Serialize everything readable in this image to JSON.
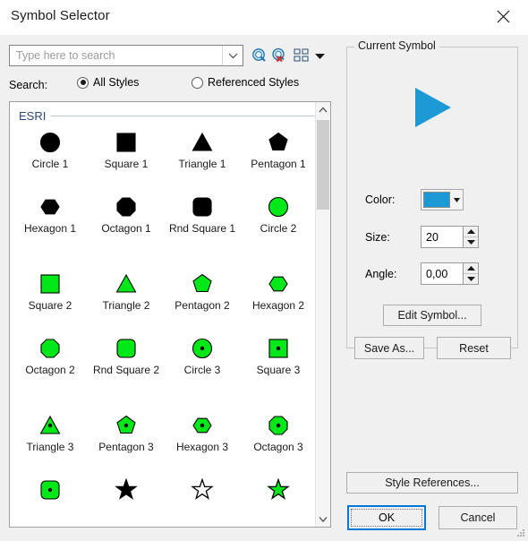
{
  "window": {
    "title": "Symbol Selector",
    "close_icon": "close-icon"
  },
  "search": {
    "placeholder": "Type here to search",
    "value": "",
    "combo_arrow_icon": "chevron-down-icon",
    "go_icon": "search-magnifier-icon",
    "clear_icon": "search-clear-icon",
    "view_mode_icon": "grid-view-icon",
    "view_mode_arrow_icon": "dropdown-arrow-icon",
    "label": "Search:",
    "options": [
      {
        "label": "All Styles",
        "checked": true
      },
      {
        "label": "Referenced Styles",
        "checked": false
      }
    ]
  },
  "symbol_list": {
    "category": "ESRI",
    "scrollbar": {
      "up_icon": "chevron-up-icon",
      "down_icon": "chevron-down-icon"
    },
    "rows": [
      [
        {
          "label": "Circle 1",
          "shape": "circle",
          "fill": "#000000",
          "stroke": "#000000",
          "dot": false
        },
        {
          "label": "Square 1",
          "shape": "square",
          "fill": "#000000",
          "stroke": "#000000",
          "dot": false
        },
        {
          "label": "Triangle 1",
          "shape": "triangle",
          "fill": "#000000",
          "stroke": "#000000",
          "dot": false
        },
        {
          "label": "Pentagon 1",
          "shape": "pentagon",
          "fill": "#000000",
          "stroke": "#000000",
          "dot": false
        }
      ],
      [
        {
          "label": "Hexagon 1",
          "shape": "hexagon",
          "fill": "#000000",
          "stroke": "#000000",
          "dot": false
        },
        {
          "label": "Octagon 1",
          "shape": "octagon",
          "fill": "#000000",
          "stroke": "#000000",
          "dot": false
        },
        {
          "label": "Rnd Square 1",
          "shape": "rndsquare",
          "fill": "#000000",
          "stroke": "#000000",
          "dot": false
        },
        {
          "label": "Circle 2",
          "shape": "circle",
          "fill": "#00e817",
          "stroke": "#000000",
          "dot": false
        }
      ],
      [
        {
          "label": "Square 2",
          "shape": "square",
          "fill": "#00e817",
          "stroke": "#000000",
          "dot": false
        },
        {
          "label": "Triangle 2",
          "shape": "triangle",
          "fill": "#00e817",
          "stroke": "#000000",
          "dot": false
        },
        {
          "label": "Pentagon 2",
          "shape": "pentagon",
          "fill": "#00e817",
          "stroke": "#000000",
          "dot": false
        },
        {
          "label": "Hexagon 2",
          "shape": "hexagon",
          "fill": "#00e817",
          "stroke": "#000000",
          "dot": false
        }
      ],
      [
        {
          "label": "Octagon 2",
          "shape": "octagon",
          "fill": "#00e817",
          "stroke": "#000000",
          "dot": false
        },
        {
          "label": "Rnd Square 2",
          "shape": "rndsquare",
          "fill": "#00e817",
          "stroke": "#000000",
          "dot": false
        },
        {
          "label": "Circle 3",
          "shape": "circle",
          "fill": "#00e817",
          "stroke": "#000000",
          "dot": true
        },
        {
          "label": "Square 3",
          "shape": "square",
          "fill": "#00e817",
          "stroke": "#000000",
          "dot": true
        }
      ],
      [
        {
          "label": "Triangle 3",
          "shape": "triangle",
          "fill": "#00e817",
          "stroke": "#000000",
          "dot": true
        },
        {
          "label": "Pentagon 3",
          "shape": "pentagon",
          "fill": "#00e817",
          "stroke": "#000000",
          "dot": true
        },
        {
          "label": "Hexagon 3",
          "shape": "hexagon",
          "fill": "#00e817",
          "stroke": "#000000",
          "dot": true
        },
        {
          "label": "Octagon 3",
          "shape": "octagon",
          "fill": "#00e817",
          "stroke": "#000000",
          "dot": true
        }
      ],
      [
        {
          "label": "",
          "shape": "rndsquare",
          "fill": "#00e817",
          "stroke": "#000000",
          "dot": true
        },
        {
          "label": "",
          "shape": "star",
          "fill": "#000000",
          "stroke": "#000000",
          "dot": false
        },
        {
          "label": "",
          "shape": "star",
          "fill": "#ffffff",
          "stroke": "#000000",
          "dot": false
        },
        {
          "label": "",
          "shape": "star",
          "fill": "#00e817",
          "stroke": "#000000",
          "dot": false
        }
      ]
    ]
  },
  "current_symbol": {
    "group_title": "Current Symbol",
    "preview_shape": "right-triangle",
    "preview_color": "#1b9ad6",
    "color_label": "Color:",
    "color_value": "#1b9ad6",
    "color_arrow_icon": "dropdown-arrow-icon",
    "size_label": "Size:",
    "size_value": "20",
    "angle_label": "Angle:",
    "angle_value": "0,00",
    "spin_up_icon": "spinner-up-icon",
    "spin_down_icon": "spinner-down-icon",
    "edit_symbol_label": "Edit Symbol...",
    "save_as_label": "Save As...",
    "reset_label": "Reset"
  },
  "footer": {
    "style_references_label": "Style References...",
    "ok_label": "OK",
    "cancel_label": "Cancel",
    "resize_grip_icon": "resize-grip-icon"
  }
}
